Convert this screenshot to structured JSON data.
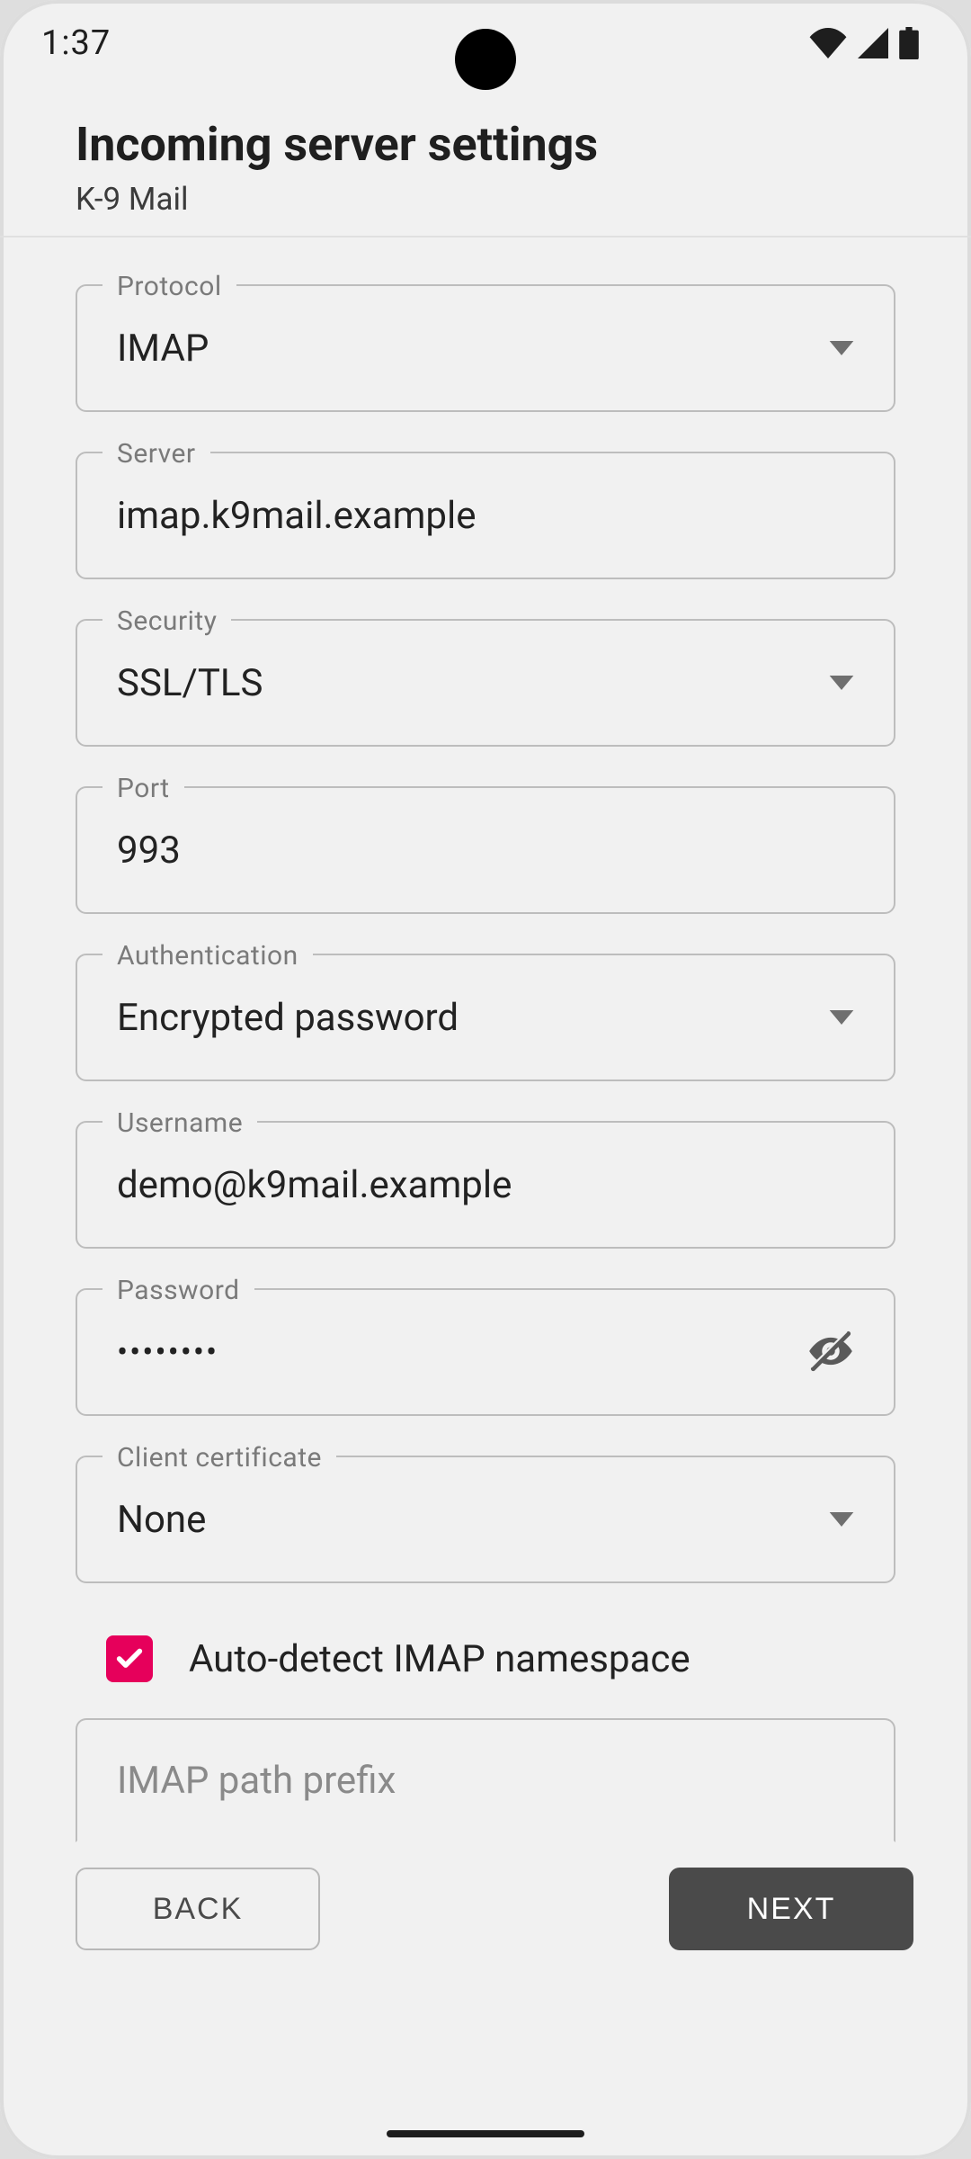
{
  "status": {
    "time": "1:37"
  },
  "header": {
    "title": "Incoming server settings",
    "subtitle": "K-9 Mail"
  },
  "fields": {
    "protocol": {
      "label": "Protocol",
      "value": "IMAP"
    },
    "server": {
      "label": "Server",
      "value": "imap.k9mail.example"
    },
    "security": {
      "label": "Security",
      "value": "SSL/TLS"
    },
    "port": {
      "label": "Port",
      "value": "993"
    },
    "authentication": {
      "label": "Authentication",
      "value": "Encrypted password"
    },
    "username": {
      "label": "Username",
      "value": "demo@k9mail.example"
    },
    "password": {
      "label": "Password",
      "value": "••••••••"
    },
    "client_cert": {
      "label": "Client certificate",
      "value": "None"
    },
    "imap_prefix": {
      "placeholder": "IMAP path prefix",
      "value": ""
    }
  },
  "checkbox": {
    "auto_detect_label": "Auto-detect IMAP namespace",
    "checked": true
  },
  "footer": {
    "back": "BACK",
    "next": "NEXT"
  },
  "colors": {
    "accent": "#e6005b"
  }
}
